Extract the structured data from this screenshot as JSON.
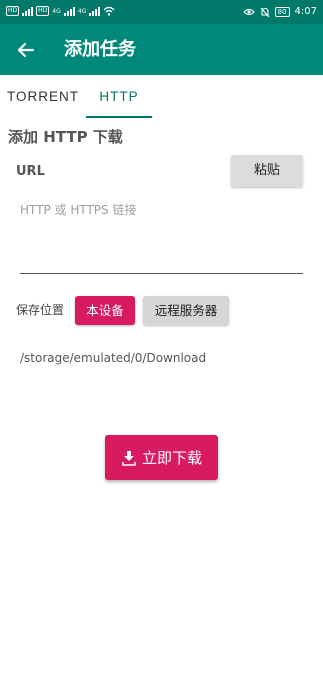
{
  "status_bar": {
    "chip_hd1": "HD",
    "chip_hd2": "HD",
    "net_4g": "4G",
    "net_4g2": "4G",
    "battery": "80",
    "time": "4:07"
  },
  "app_bar": {
    "back_icon": "arrow-back-icon",
    "title": "添加任务",
    "color": "#00897b"
  },
  "tabs": [
    {
      "label": "TORRENT",
      "active": false
    },
    {
      "label": "HTTP",
      "active": true
    }
  ],
  "form": {
    "section_title": "添加 HTTP 下载",
    "url_label": "URL",
    "paste_label": "粘贴",
    "url_placeholder": "HTTP 或 HTTPS 链接",
    "url_value": "",
    "save_location_label": "保存位置",
    "local_device_label": "本设备",
    "remote_server_label": "远程服务器",
    "selected_location": "本设备",
    "path": "/storage/emulated/0/Download",
    "download_label": "立即下载",
    "download_icon": "download-icon"
  },
  "colors": {
    "primary": "#00897b",
    "status_bar": "#00796b",
    "accent": "#d81b60"
  }
}
